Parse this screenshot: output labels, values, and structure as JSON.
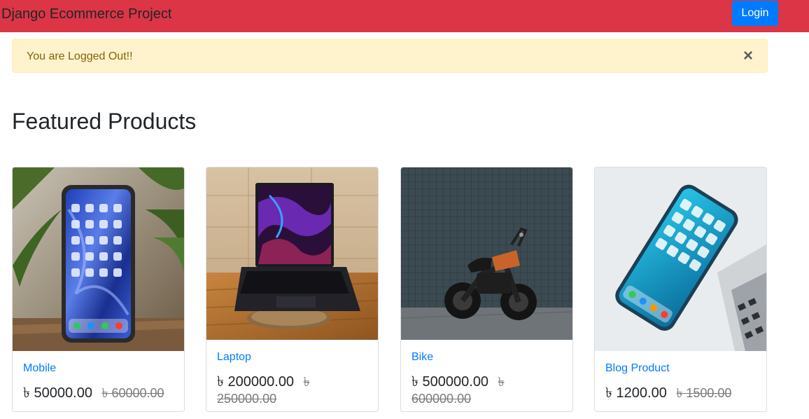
{
  "navbar": {
    "brand": "Django Ecommerce Project",
    "login_label": "Login"
  },
  "alert": {
    "message": "You are Logged Out!!",
    "close": "×"
  },
  "featured": {
    "title": "Featured Products"
  },
  "products": [
    {
      "name": "Mobile",
      "price": "৳ 50000.00",
      "old_price": "৳ 60000.00"
    },
    {
      "name": "Laptop",
      "price": "৳ 200000.00",
      "old_price": "৳ 250000.00"
    },
    {
      "name": "Bike",
      "price": "৳ 500000.00",
      "old_price": "৳ 600000.00"
    },
    {
      "name": "Blog Product",
      "price": "৳ 1200.00",
      "old_price": "৳ 1500.00"
    }
  ]
}
